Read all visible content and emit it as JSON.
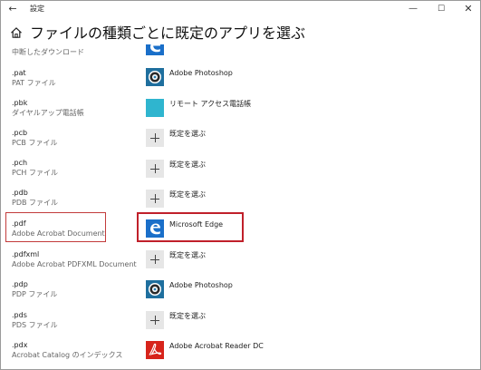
{
  "window": {
    "title": "設定",
    "back_glyph": "←",
    "minimize_glyph": "—",
    "maximize_glyph": "☐",
    "close_glyph": "✕"
  },
  "header": {
    "title": "ファイルの種類ごとに既定のアプリを選ぶ"
  },
  "rows": [
    {
      "ext": "",
      "desc": "中断したダウンロード",
      "app": "",
      "app_icon": "microsoft-edge-icon"
    },
    {
      "ext": ".pat",
      "desc": "PAT ファイル",
      "app": "Adobe Photoshop",
      "app_icon": "photoshop-icon"
    },
    {
      "ext": ".pbk",
      "desc": "ダイヤルアップ電話帳",
      "app": "リモート アクセス電話帳",
      "app_icon": "remote-access-icon"
    },
    {
      "ext": ".pcb",
      "desc": "PCB ファイル",
      "app": "既定を選ぶ",
      "app_icon": "plus-icon"
    },
    {
      "ext": ".pch",
      "desc": "PCH ファイル",
      "app": "既定を選ぶ",
      "app_icon": "plus-icon"
    },
    {
      "ext": ".pdb",
      "desc": "PDB ファイル",
      "app": "既定を選ぶ",
      "app_icon": "plus-icon"
    },
    {
      "ext": ".pdf",
      "desc": "Adobe Acrobat Document",
      "app": "Microsoft Edge",
      "app_icon": "microsoft-edge-icon"
    },
    {
      "ext": ".pdfxml",
      "desc": "Adobe Acrobat PDFXML Document",
      "app": "既定を選ぶ",
      "app_icon": "plus-icon"
    },
    {
      "ext": ".pdp",
      "desc": "PDP ファイル",
      "app": "Adobe Photoshop",
      "app_icon": "photoshop-icon"
    },
    {
      "ext": ".pds",
      "desc": "PDS ファイル",
      "app": "既定を選ぶ",
      "app_icon": "plus-icon"
    },
    {
      "ext": ".pdx",
      "desc": "Acrobat Catalog のインデックス",
      "app": "Adobe Acrobat Reader DC",
      "app_icon": "acrobat-reader-icon"
    }
  ],
  "colors": {
    "accent": "#0078d7",
    "highlight": "#c0202a",
    "remote_access": "#2fb5cf",
    "acrobat_red": "#d7241b"
  }
}
